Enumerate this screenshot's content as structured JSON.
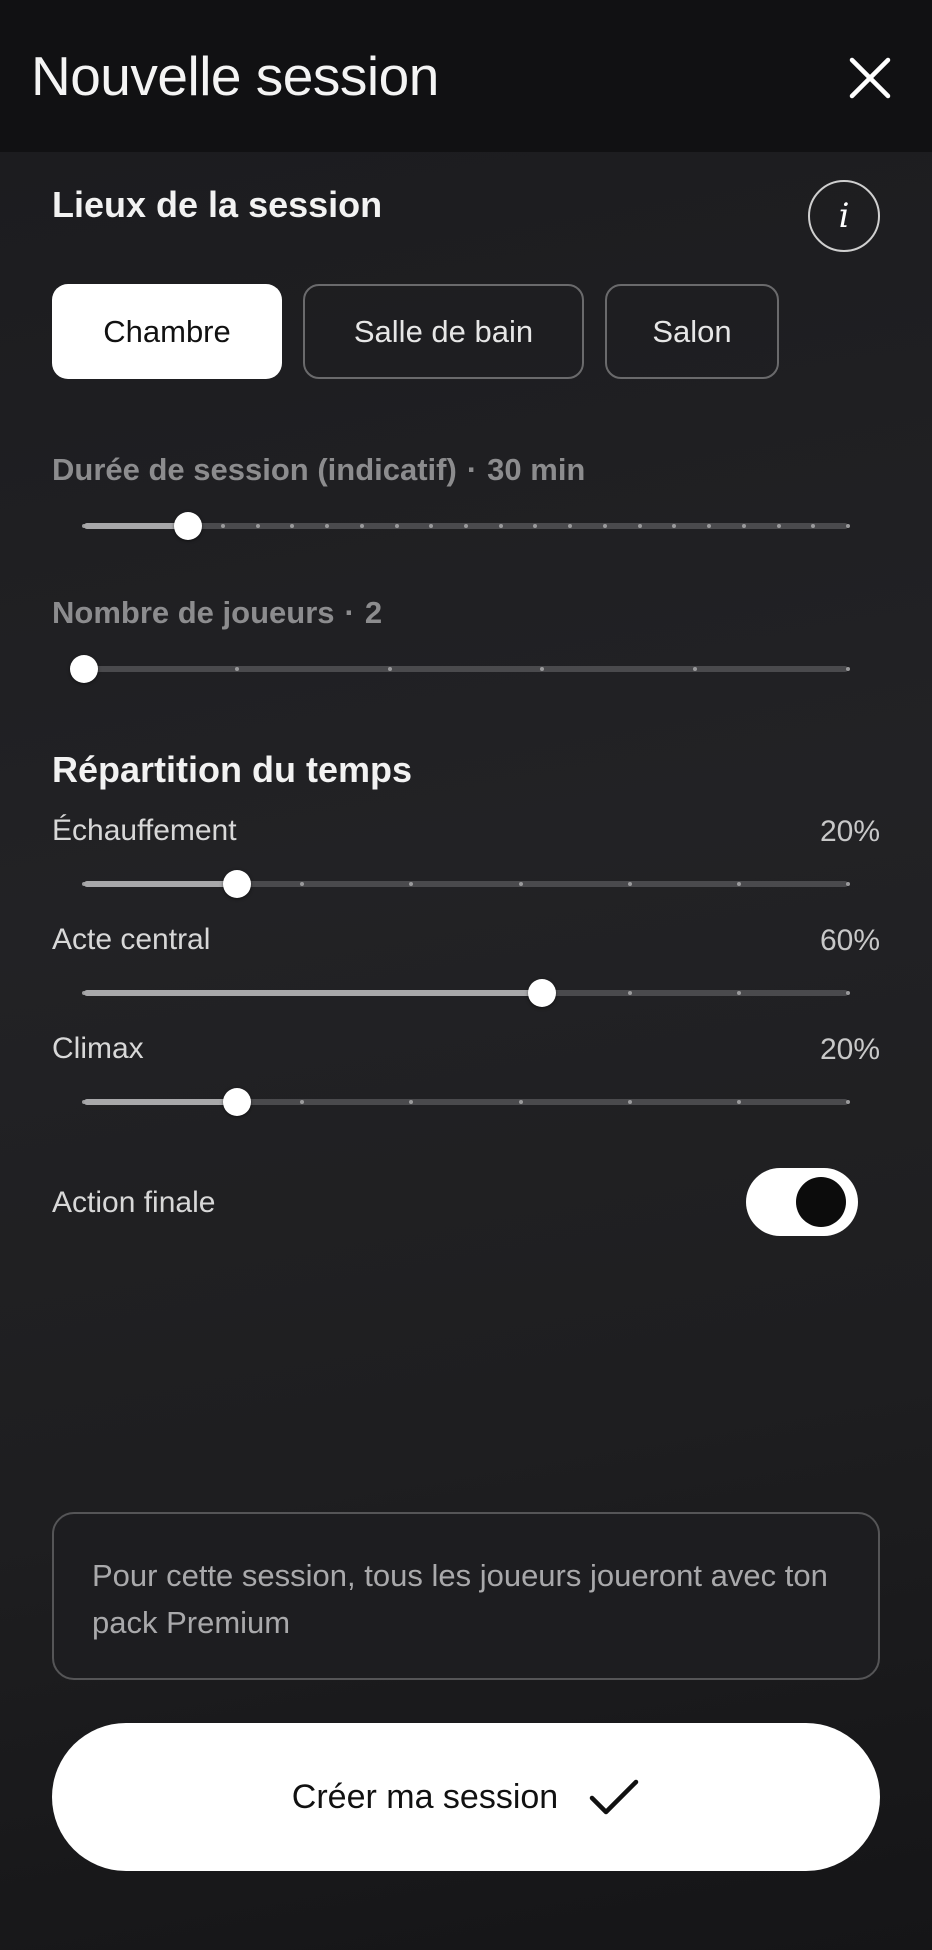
{
  "header": {
    "title": "Nouvelle session"
  },
  "locations": {
    "title": "Lieux de la session",
    "info_symbol": "i",
    "options": [
      "Chambre",
      "Salle de bain",
      "Salon"
    ],
    "selected": "Chambre"
  },
  "duration": {
    "label": "Durée de session (indicatif)",
    "separator": "·",
    "value": "30 min",
    "slider_steps": 22,
    "slider_index": 3
  },
  "players": {
    "label": "Nombre de joueurs",
    "separator": "·",
    "value": "2",
    "slider_steps": 5,
    "slider_index": 0
  },
  "time_split": {
    "title": "Répartition du temps",
    "rows": [
      {
        "label": "Échauffement",
        "value": "20%",
        "percent": 20
      },
      {
        "label": "Acte central",
        "value": "60%",
        "percent": 60
      },
      {
        "label": "Climax",
        "value": "20%",
        "percent": 20
      }
    ]
  },
  "final_action": {
    "label": "Action finale",
    "enabled": true
  },
  "notice": {
    "text": "Pour cette session, tous les joueurs joueront avec ton pack Premium"
  },
  "cta": {
    "label": "Créer ma session"
  },
  "colors": {
    "background": "#151517",
    "accent": "#ffffff",
    "muted": "#8c8c8e"
  },
  "icons": {
    "close": "close-icon",
    "confirm": "checkmark-icon",
    "info": "info-icon"
  }
}
